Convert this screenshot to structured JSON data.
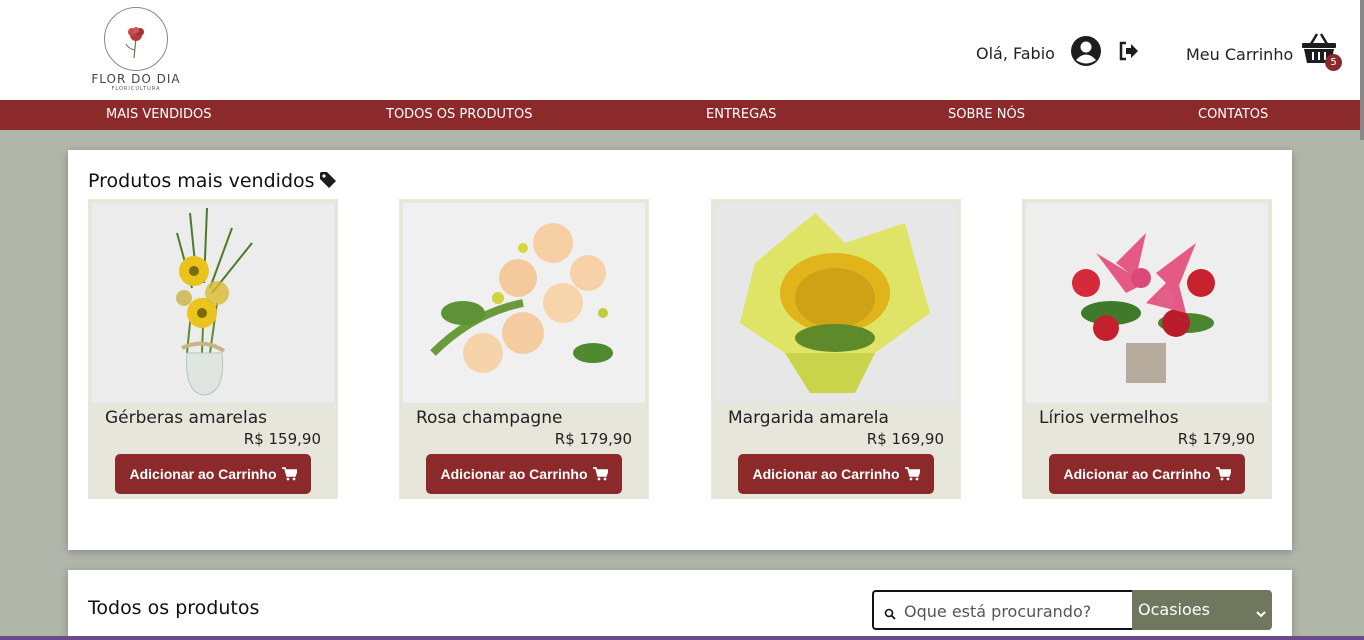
{
  "brand": {
    "name": "FLOR DO DIA",
    "tagline": "FLORICULTURA"
  },
  "header": {
    "greeting": "Olá, Fabio",
    "cart_label": "Meu Carrinho",
    "cart_count": "5"
  },
  "nav": [
    {
      "label": "MAIS VENDIDOS"
    },
    {
      "label": "TODOS OS PRODUTOS"
    },
    {
      "label": "ENTREGAS"
    },
    {
      "label": "SOBRE NÓS"
    },
    {
      "label": "CONTATOS"
    }
  ],
  "best_sellers": {
    "title": "Produtos mais vendidos",
    "add_label": "Adicionar ao Carrinho",
    "products": [
      {
        "name": "Gérberas amarelas",
        "price": "R$ 159,90"
      },
      {
        "name": "Rosa champagne",
        "price": "R$ 179,90"
      },
      {
        "name": "Margarida amarela",
        "price": "R$ 169,90"
      },
      {
        "name": "Lírios vermelhos",
        "price": "R$ 179,90"
      }
    ]
  },
  "all_products": {
    "title": "Todos os produtos",
    "search_placeholder": "Oque está procurando?",
    "filter_selected": "Ocasioes"
  },
  "colors": {
    "brand_red": "#8c2a2b",
    "card_bg": "#e6e6da",
    "page_bg": "#b1b6ab",
    "select_bg": "#6f775e"
  }
}
